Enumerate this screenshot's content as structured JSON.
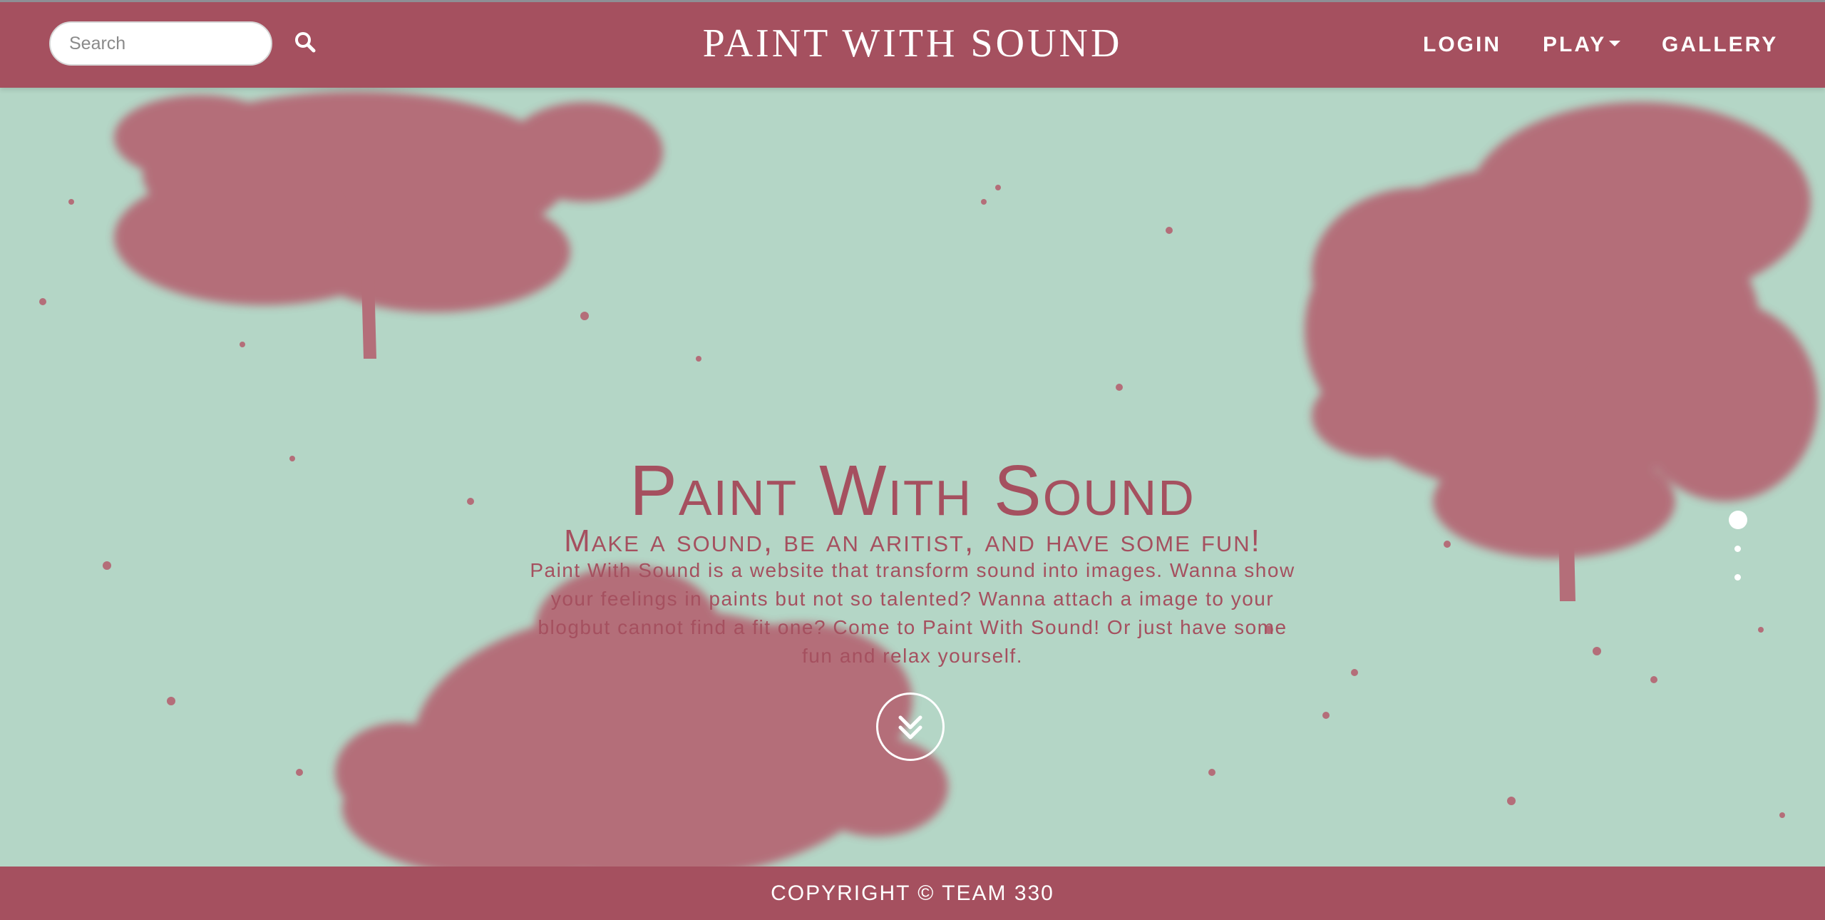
{
  "header": {
    "search_placeholder": "Search",
    "brand": "PAINT WITH SOUND",
    "nav": {
      "login": "LOGIN",
      "play": "PLAY",
      "gallery": "GALLERY"
    }
  },
  "hero": {
    "title": "Paint With Sound",
    "subtitle": "Make a sound, be an aritist, and have some fun!",
    "description": "Paint With Sound is a website that transform sound into images. Wanna show your feelings in paints but not so talented? Wanna attach a image to your blogbut cannot find a fit one? Come to Paint With Sound! Or just have some fun and relax yourself."
  },
  "carousel": {
    "active_index": 0,
    "count": 3
  },
  "footer": {
    "copyright": "COPYRIGHT © TEAM 330"
  },
  "colors": {
    "primary": "#a5505f",
    "background": "#b4d6c6",
    "text_on_primary": "#ffffff"
  },
  "icons": {
    "search": "search-icon",
    "dropdown": "caret-down-icon",
    "scroll": "double-chevron-down-icon"
  }
}
